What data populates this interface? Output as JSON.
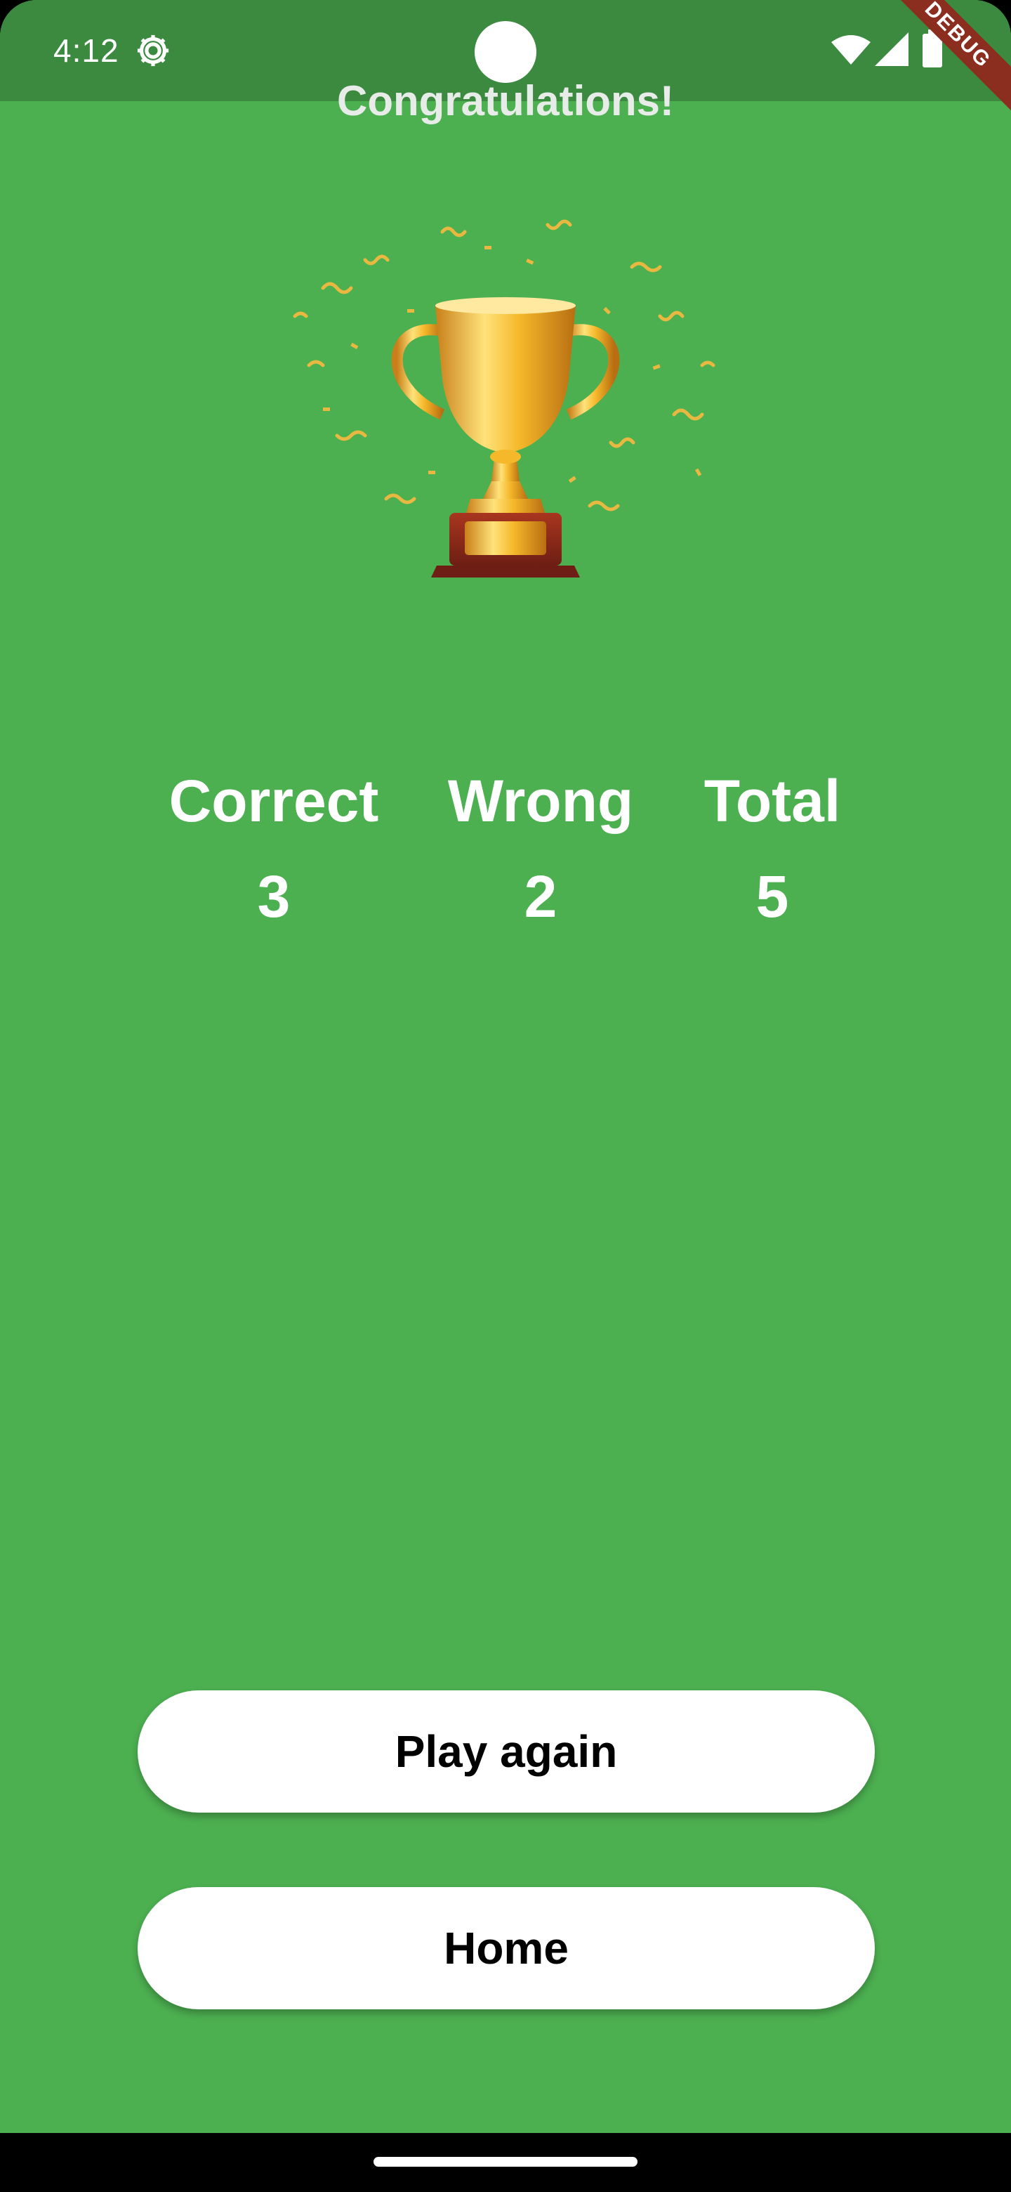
{
  "status_bar": {
    "time": "4:12",
    "icons": [
      "settings-icon",
      "wifi-icon",
      "signal-icon",
      "battery-icon"
    ],
    "debug_label": "DEBUG"
  },
  "header": {
    "title": "Congratulations!"
  },
  "hero": {
    "image": "trophy-with-confetti"
  },
  "stats": [
    {
      "label": "Correct",
      "value": "3"
    },
    {
      "label": "Wrong",
      "value": "2"
    },
    {
      "label": "Total",
      "value": "5"
    }
  ],
  "actions": {
    "play_again_label": "Play again",
    "home_label": "Home"
  },
  "colors": {
    "background": "#4CAF50",
    "status_bar": "#3B8A40",
    "button": "#FFFFFF",
    "trophy_gold": "#F2B21C",
    "trophy_base": "#8E2A1C",
    "debug_banner": "#8B2E20"
  }
}
